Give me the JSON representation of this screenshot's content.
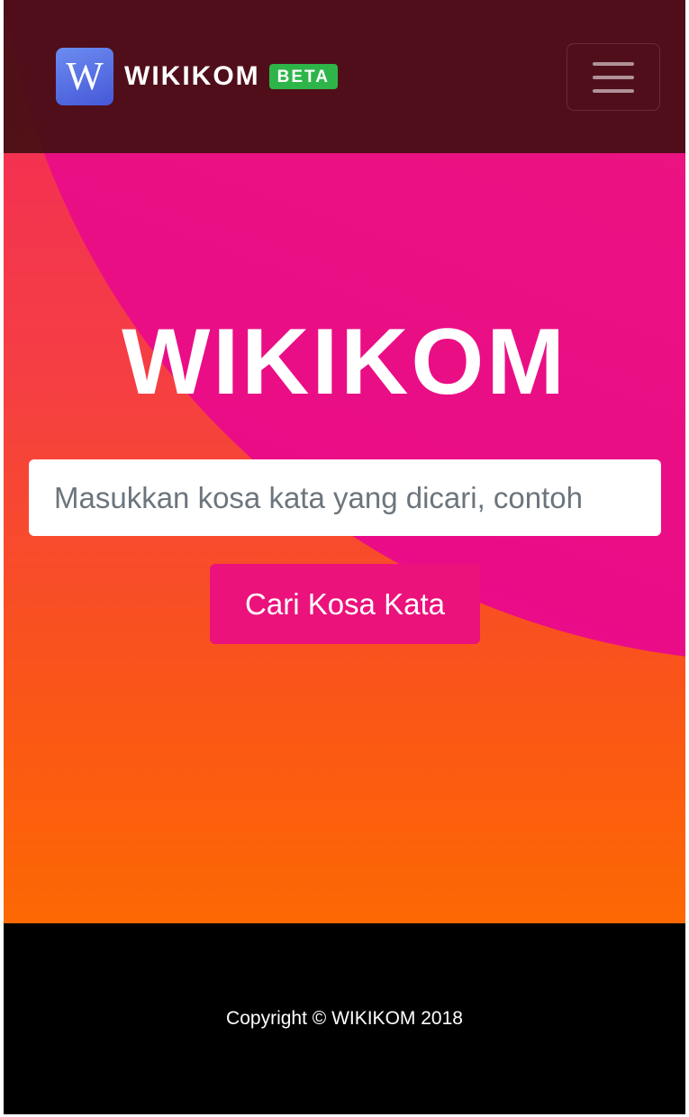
{
  "navbar": {
    "logo_letter": "W",
    "brand_name": "WIKIKOM",
    "badge": "BETA",
    "menu_icon": "hamburger-menu-icon"
  },
  "hero": {
    "title": "WIKIKOM",
    "search_placeholder": "Masukkan kosa kata yang dicari, contoh",
    "search_value": "",
    "button_label": "Cari Kosa Kata"
  },
  "footer": {
    "copyright": "Copyright © WIKIKOM 2018"
  },
  "colors": {
    "navbar_bg": "#420e12",
    "gradient_top": "#f2295a",
    "gradient_bottom": "#fd6803",
    "accent_pink": "#eb127c",
    "badge_green": "#2eb54a",
    "logo_blue": "#4f66e0",
    "footer_bg": "#000000"
  }
}
